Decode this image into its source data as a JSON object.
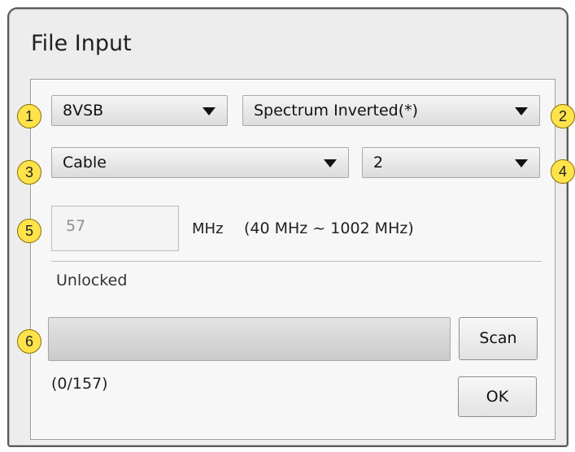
{
  "window": {
    "title": "File Input"
  },
  "modulation": {
    "value": "8VSB"
  },
  "spectrum": {
    "value": "Spectrum Inverted(*)"
  },
  "network": {
    "value": "Cable"
  },
  "channel": {
    "value": "2"
  },
  "frequency": {
    "value": "57",
    "unit": "MHz",
    "range": "(40 MHz ~ 1002 MHz)"
  },
  "status": {
    "text": "Unlocked"
  },
  "scan": {
    "progress": 0,
    "count_text": "(0/157)",
    "button_label": "Scan"
  },
  "ok_button": {
    "label": "OK"
  },
  "callouts": [
    "1",
    "2",
    "3",
    "4",
    "5",
    "6"
  ],
  "colors": {
    "callout_fill": "#ffe34a",
    "dialog_bg": "#ededed",
    "panel_bg": "#f7f7f7"
  },
  "icons": {
    "dropdown": "dropdown-arrow-icon"
  }
}
